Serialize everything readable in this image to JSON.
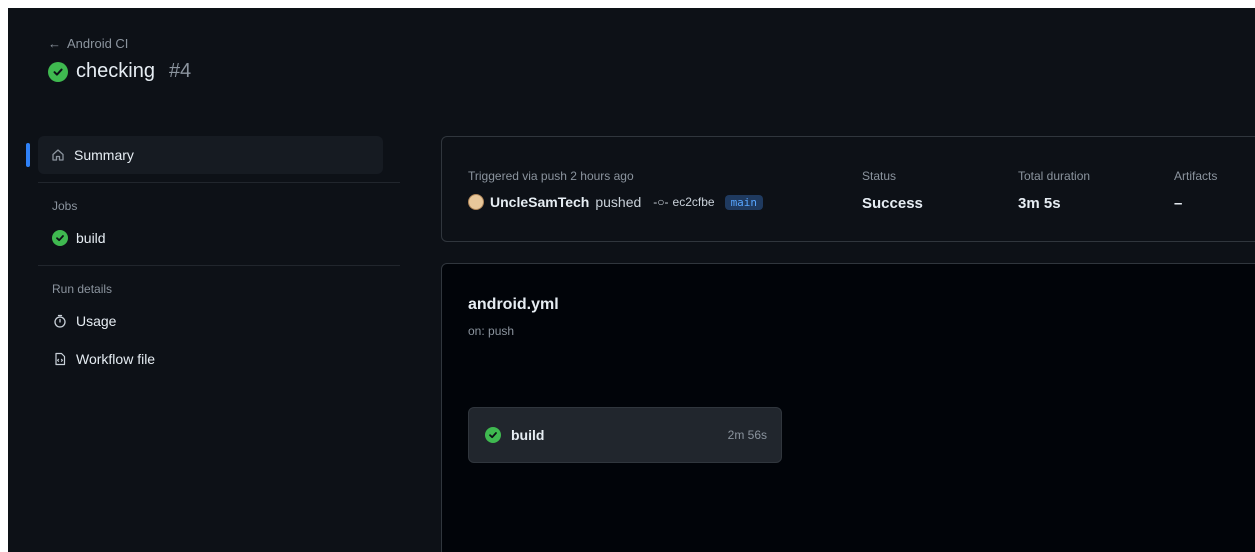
{
  "header": {
    "back_label": "Android CI",
    "run_title": "checking",
    "run_number": "#4"
  },
  "sidebar": {
    "summary_label": "Summary",
    "jobs_heading": "Jobs",
    "jobs": [
      {
        "label": "build",
        "status": "success"
      }
    ],
    "run_details_heading": "Run details",
    "usage_label": "Usage",
    "workflow_file_label": "Workflow file"
  },
  "summary": {
    "trigger_label": "Triggered via push 2 hours ago",
    "actor": "UncleSamTech",
    "action": "pushed",
    "commit_sha": "ec2cfbe",
    "branch": "main",
    "status_label": "Status",
    "status_value": "Success",
    "duration_label": "Total duration",
    "duration_value": "3m 5s",
    "artifacts_label": "Artifacts",
    "artifacts_value": "–"
  },
  "workflow": {
    "file_name": "android.yml",
    "trigger": "on: push",
    "job": {
      "name": "build",
      "duration": "2m 56s"
    }
  },
  "colors": {
    "background": "#0d1117",
    "success": "#3fb950",
    "accent": "#2f81f7",
    "branch_text": "#58a6ff"
  }
}
